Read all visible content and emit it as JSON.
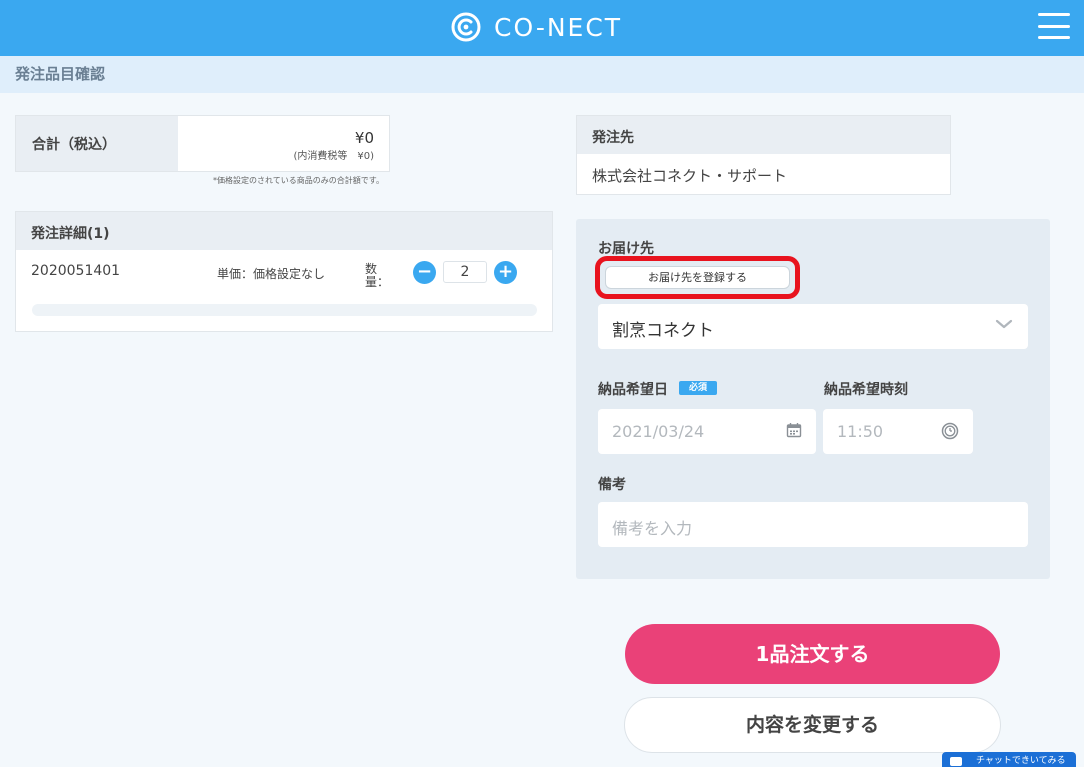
{
  "header": {
    "brand": "CO-NECT",
    "logo_icon": "co-nect-logo-icon",
    "menu_icon": "hamburger-menu-icon"
  },
  "page": {
    "title": "発注品目確認"
  },
  "total": {
    "label": "合計（税込）",
    "amount": "¥0",
    "tax": "(内消費税等　¥0)",
    "note": "*価格設定のされている商品のみの合計額です。"
  },
  "details": {
    "title": "発注詳細(1)",
    "items": [
      {
        "code": "2020051401",
        "price": "単価：価格設定なし",
        "qty_label": "数量：",
        "qty": "2"
      }
    ]
  },
  "supplier": {
    "label": "発注先",
    "name": "株式会社コネクト・サポート"
  },
  "delivery": {
    "label": "お届け先",
    "register_label": "お届け先を登録する",
    "selected": "割烹コネクト",
    "date_label": "納品希望日",
    "required_badge": "必須",
    "date_value": "2021/03/24",
    "time_label": "納品希望時刻",
    "time_value": "11:50",
    "notes_label": "備考",
    "notes_placeholder": "備考を入力"
  },
  "actions": {
    "order": "1品注文する",
    "change": "内容を変更する"
  },
  "chat": {
    "label": "チャットできいてみる"
  },
  "colors": {
    "brand": "#3aa8f0",
    "order": "#ea4178",
    "highlight": "#e8131e"
  }
}
